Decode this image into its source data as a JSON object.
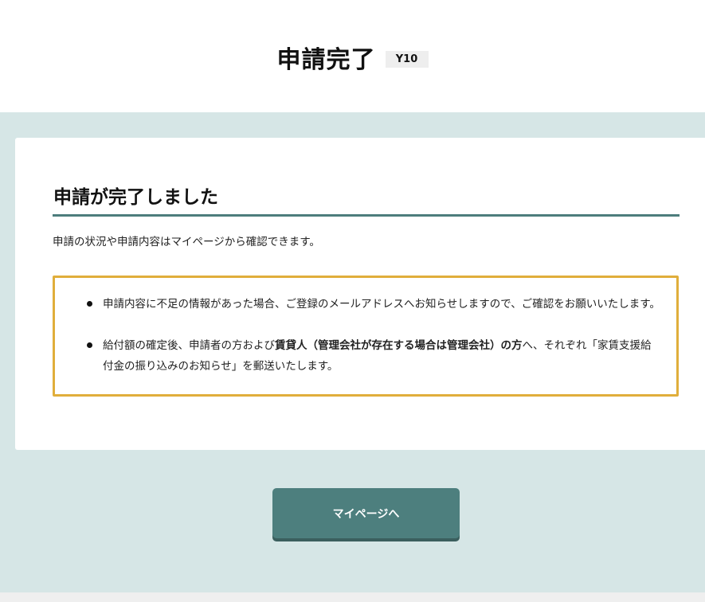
{
  "header": {
    "title": "申請完了",
    "screen_code": "Y10"
  },
  "card": {
    "title": "申請が完了しました",
    "lead": "申請の状況や申請内容はマイページから確認できます。",
    "notices": [
      {
        "text": "申請内容に不足の情報があった場合、ご登録のメールアドレスへお知らせしますので、ご確認をお願いいたします。"
      },
      {
        "before": "給付額の確定後、申請者の方および",
        "bold": "賃貸人（管理会社が存在する場合は管理会社）の方",
        "after": "へ、それぞれ「家賃支援給付金の振り込みのお知らせ」を郵送いたします。"
      }
    ]
  },
  "mypage_button": {
    "label": "マイページへ"
  },
  "colors": {
    "accent_teal": "#4d7f7e",
    "background_teal": "#d6e6e6",
    "notice_border": "#e0ae3b"
  }
}
